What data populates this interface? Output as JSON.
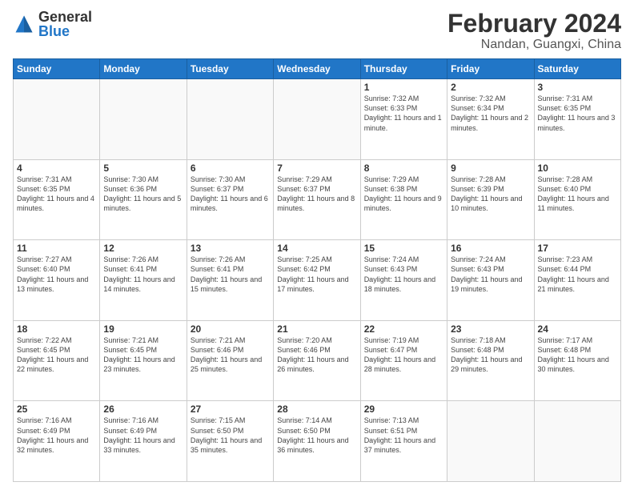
{
  "logo": {
    "general": "General",
    "blue": "Blue"
  },
  "title": "February 2024",
  "location": "Nandan, Guangxi, China",
  "days_of_week": [
    "Sunday",
    "Monday",
    "Tuesday",
    "Wednesday",
    "Thursday",
    "Friday",
    "Saturday"
  ],
  "weeks": [
    [
      {
        "day": "",
        "info": ""
      },
      {
        "day": "",
        "info": ""
      },
      {
        "day": "",
        "info": ""
      },
      {
        "day": "",
        "info": ""
      },
      {
        "day": "1",
        "info": "Sunrise: 7:32 AM\nSunset: 6:33 PM\nDaylight: 11 hours and 1 minute."
      },
      {
        "day": "2",
        "info": "Sunrise: 7:32 AM\nSunset: 6:34 PM\nDaylight: 11 hours and 2 minutes."
      },
      {
        "day": "3",
        "info": "Sunrise: 7:31 AM\nSunset: 6:35 PM\nDaylight: 11 hours and 3 minutes."
      }
    ],
    [
      {
        "day": "4",
        "info": "Sunrise: 7:31 AM\nSunset: 6:35 PM\nDaylight: 11 hours and 4 minutes."
      },
      {
        "day": "5",
        "info": "Sunrise: 7:30 AM\nSunset: 6:36 PM\nDaylight: 11 hours and 5 minutes."
      },
      {
        "day": "6",
        "info": "Sunrise: 7:30 AM\nSunset: 6:37 PM\nDaylight: 11 hours and 6 minutes."
      },
      {
        "day": "7",
        "info": "Sunrise: 7:29 AM\nSunset: 6:37 PM\nDaylight: 11 hours and 8 minutes."
      },
      {
        "day": "8",
        "info": "Sunrise: 7:29 AM\nSunset: 6:38 PM\nDaylight: 11 hours and 9 minutes."
      },
      {
        "day": "9",
        "info": "Sunrise: 7:28 AM\nSunset: 6:39 PM\nDaylight: 11 hours and 10 minutes."
      },
      {
        "day": "10",
        "info": "Sunrise: 7:28 AM\nSunset: 6:40 PM\nDaylight: 11 hours and 11 minutes."
      }
    ],
    [
      {
        "day": "11",
        "info": "Sunrise: 7:27 AM\nSunset: 6:40 PM\nDaylight: 11 hours and 13 minutes."
      },
      {
        "day": "12",
        "info": "Sunrise: 7:26 AM\nSunset: 6:41 PM\nDaylight: 11 hours and 14 minutes."
      },
      {
        "day": "13",
        "info": "Sunrise: 7:26 AM\nSunset: 6:41 PM\nDaylight: 11 hours and 15 minutes."
      },
      {
        "day": "14",
        "info": "Sunrise: 7:25 AM\nSunset: 6:42 PM\nDaylight: 11 hours and 17 minutes."
      },
      {
        "day": "15",
        "info": "Sunrise: 7:24 AM\nSunset: 6:43 PM\nDaylight: 11 hours and 18 minutes."
      },
      {
        "day": "16",
        "info": "Sunrise: 7:24 AM\nSunset: 6:43 PM\nDaylight: 11 hours and 19 minutes."
      },
      {
        "day": "17",
        "info": "Sunrise: 7:23 AM\nSunset: 6:44 PM\nDaylight: 11 hours and 21 minutes."
      }
    ],
    [
      {
        "day": "18",
        "info": "Sunrise: 7:22 AM\nSunset: 6:45 PM\nDaylight: 11 hours and 22 minutes."
      },
      {
        "day": "19",
        "info": "Sunrise: 7:21 AM\nSunset: 6:45 PM\nDaylight: 11 hours and 23 minutes."
      },
      {
        "day": "20",
        "info": "Sunrise: 7:21 AM\nSunset: 6:46 PM\nDaylight: 11 hours and 25 minutes."
      },
      {
        "day": "21",
        "info": "Sunrise: 7:20 AM\nSunset: 6:46 PM\nDaylight: 11 hours and 26 minutes."
      },
      {
        "day": "22",
        "info": "Sunrise: 7:19 AM\nSunset: 6:47 PM\nDaylight: 11 hours and 28 minutes."
      },
      {
        "day": "23",
        "info": "Sunrise: 7:18 AM\nSunset: 6:48 PM\nDaylight: 11 hours and 29 minutes."
      },
      {
        "day": "24",
        "info": "Sunrise: 7:17 AM\nSunset: 6:48 PM\nDaylight: 11 hours and 30 minutes."
      }
    ],
    [
      {
        "day": "25",
        "info": "Sunrise: 7:16 AM\nSunset: 6:49 PM\nDaylight: 11 hours and 32 minutes."
      },
      {
        "day": "26",
        "info": "Sunrise: 7:16 AM\nSunset: 6:49 PM\nDaylight: 11 hours and 33 minutes."
      },
      {
        "day": "27",
        "info": "Sunrise: 7:15 AM\nSunset: 6:50 PM\nDaylight: 11 hours and 35 minutes."
      },
      {
        "day": "28",
        "info": "Sunrise: 7:14 AM\nSunset: 6:50 PM\nDaylight: 11 hours and 36 minutes."
      },
      {
        "day": "29",
        "info": "Sunrise: 7:13 AM\nSunset: 6:51 PM\nDaylight: 11 hours and 37 minutes."
      },
      {
        "day": "",
        "info": ""
      },
      {
        "day": "",
        "info": ""
      }
    ]
  ]
}
